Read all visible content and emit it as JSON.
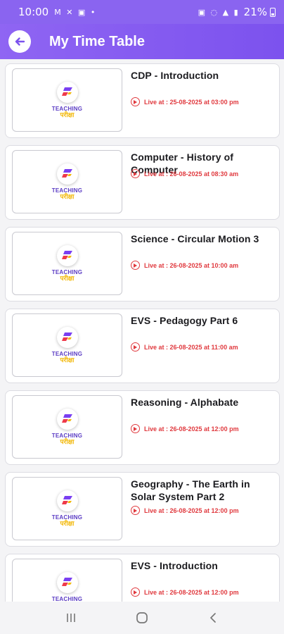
{
  "status_bar": {
    "time": "10:00",
    "left_icons": "M ✕ ▣ •",
    "right_icons": "▣ ◌ ▲ ▮",
    "battery": "21%"
  },
  "app_bar": {
    "title": "My Time Table",
    "back_icon": "arrow-left-icon",
    "color": "#8a64f0"
  },
  "logo": {
    "line1": "TEACHING",
    "line2": "परीक्षा"
  },
  "live_color": "#e0393e",
  "classes": [
    {
      "title": "CDP - Introduction",
      "live": "Live at : 25-08-2025 at 03:00 pm"
    },
    {
      "title": "Computer - History of Computer",
      "live": "Live at : 26-08-2025 at 08:30 am"
    },
    {
      "title": "Science - Circular Motion 3",
      "live": "Live at : 26-08-2025 at 10:00 am"
    },
    {
      "title": "EVS - Pedagogy Part 6",
      "live": "Live at : 26-08-2025 at 11:00 am"
    },
    {
      "title": "Reasoning - Alphabate",
      "live": "Live at : 26-08-2025 at 12:00 pm"
    },
    {
      "title": "Geography - The Earth in Solar System Part 2",
      "live": "Live at : 26-08-2025 at 12:00 pm"
    },
    {
      "title": "EVS - Introduction",
      "live": "Live at : 26-08-2025 at 12:00 pm"
    }
  ],
  "nav_bar": {
    "icons": [
      "recent-apps-icon",
      "home-icon",
      "back-icon"
    ]
  }
}
